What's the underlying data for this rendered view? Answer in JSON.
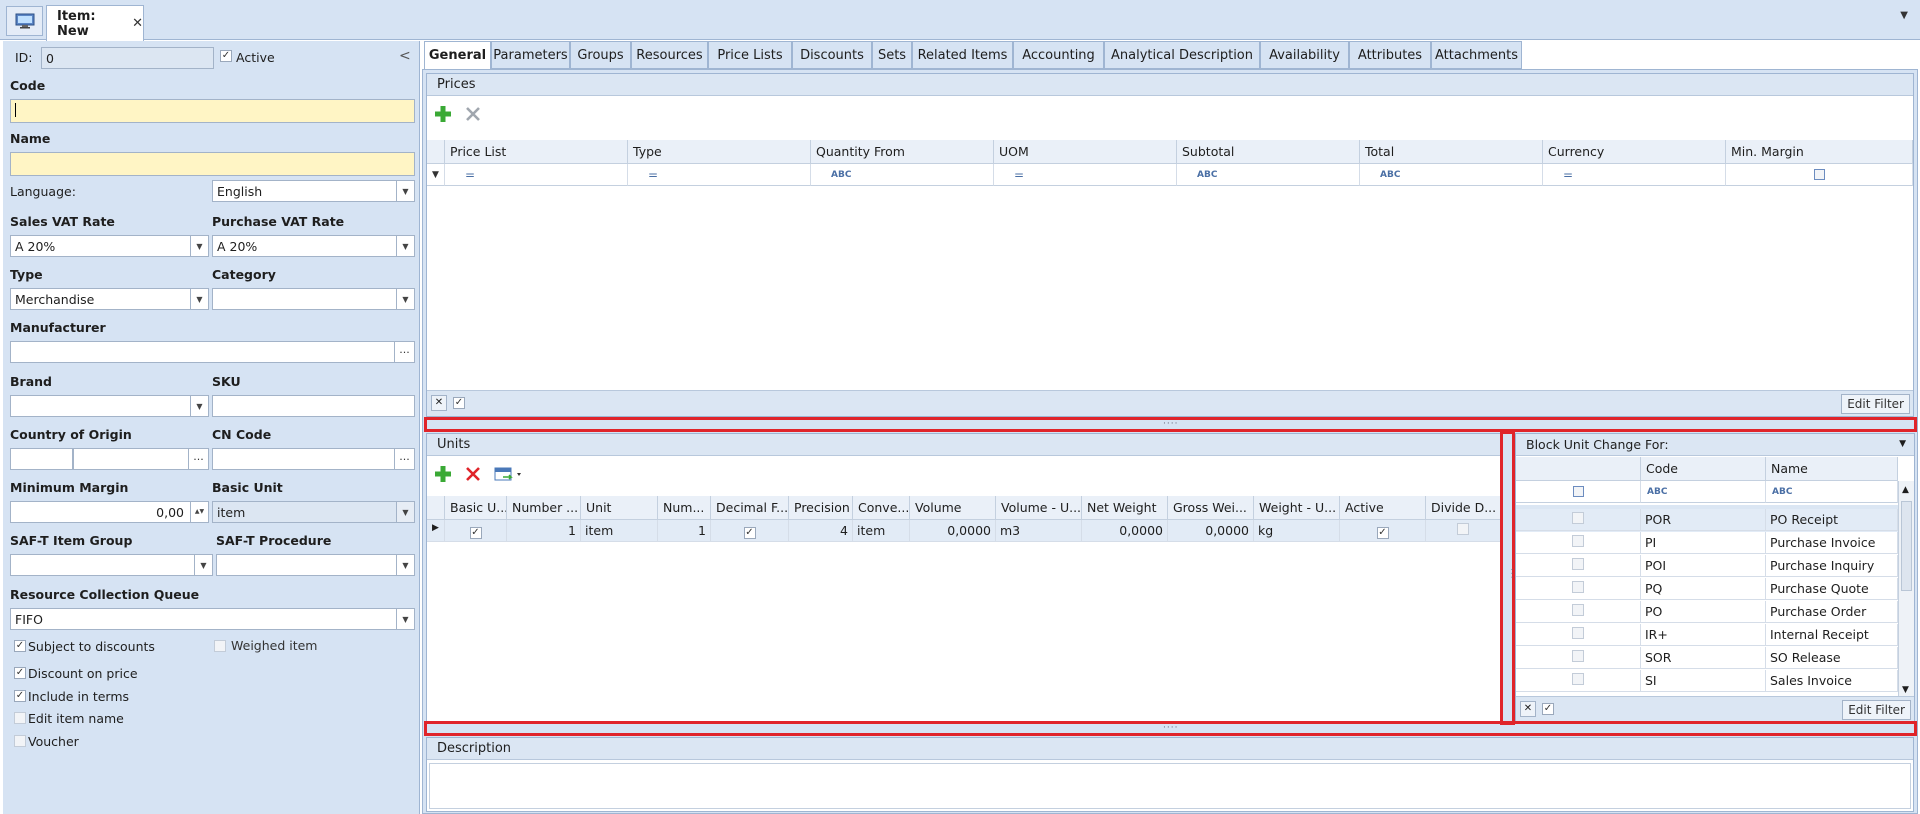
{
  "doc_tab": {
    "title": "Item: New",
    "close": "✕"
  },
  "left": {
    "id_label": "ID:",
    "id_value": "0",
    "active_label": "Active",
    "collapse": "<",
    "code_label": "Code",
    "code_value": "",
    "name_label": "Name",
    "name_value": "",
    "language_label": "Language:",
    "language_value": "English",
    "sales_vat_label": "Sales VAT Rate",
    "sales_vat_value": "A 20%",
    "purchase_vat_label": "Purchase VAT Rate",
    "purchase_vat_value": "A 20%",
    "type_label": "Type",
    "type_value": "Merchandise",
    "category_label": "Category",
    "category_value": "",
    "manufacturer_label": "Manufacturer",
    "manufacturer_value": "",
    "brand_label": "Brand",
    "brand_value": "",
    "sku_label": "SKU",
    "sku_value": "",
    "country_label": "Country of Origin",
    "cn_label": "CN Code",
    "min_margin_label": "Minimum Margin",
    "min_margin_value": "0,00",
    "basic_unit_label": "Basic Unit",
    "basic_unit_value": "item",
    "saft_group_label": "SAF-T Item Group",
    "saft_proc_label": "SAF-T Procedure",
    "rcq_label": "Resource Collection Queue",
    "rcq_value": "FIFO",
    "subject_discounts": "Subject to discounts",
    "weighed_item": "Weighed item",
    "discount_on_price": "Discount on price",
    "include_in_terms": "Include in terms",
    "edit_item_name": "Edit item name",
    "voucher": "Voucher",
    "check_mark": "✓",
    "ellipsis": "···",
    "dd_arrow": "▼",
    "spin": "▲▼"
  },
  "tabs": [
    "General",
    "Parameters",
    "Groups",
    "Resources",
    "Price Lists",
    "Discounts",
    "Sets",
    "Related Items",
    "Accounting",
    "Analytical Description",
    "Availability",
    "Attributes",
    "Attachments"
  ],
  "prices": {
    "title": "Prices",
    "columns": [
      "Price List",
      "Type",
      "Quantity From",
      "UOM",
      "Subtotal",
      "Total",
      "Currency",
      "Min. Margin"
    ],
    "filter_symbols": [
      "=",
      "=",
      "ABC",
      "=",
      "ABC",
      "ABC",
      "=",
      ""
    ],
    "edit_filter": "Edit Filter"
  },
  "units": {
    "title": "Units",
    "columns": [
      "Basic U...",
      "Number ...",
      "Unit",
      "Num...",
      "Decimal F...",
      "Precision",
      "Conve...",
      "Volume",
      "Volume - U...",
      "Net Weight",
      "Gross Wei...",
      "Weight - U...",
      "Active",
      "Divide D..."
    ],
    "row": [
      "✓",
      "1",
      "item",
      "1",
      "✓",
      "4",
      "item",
      "0,0000",
      "m3",
      "0,0000",
      "0,0000",
      "kg",
      "✓",
      ""
    ]
  },
  "block": {
    "title": "Block Unit Change For:",
    "col_code": "Code",
    "col_name": "Name",
    "rows": [
      {
        "code": "POR",
        "name": "PO Receipt"
      },
      {
        "code": "PI",
        "name": "Purchase Invoice"
      },
      {
        "code": "POI",
        "name": "Purchase Inquiry"
      },
      {
        "code": "PQ",
        "name": "Purchase Quote"
      },
      {
        "code": "PO",
        "name": "Purchase Order"
      },
      {
        "code": "IR+",
        "name": "Internal Receipt"
      },
      {
        "code": "SOR",
        "name": "SO Release"
      },
      {
        "code": "SI",
        "name": "Sales Invoice"
      }
    ],
    "edit_filter": "Edit Filter"
  },
  "description": {
    "title": "Description",
    "value": ""
  },
  "colors": {
    "accent_red": "#e0242a",
    "panel_blue": "#d6e3f3",
    "required_yellow": "#fff5c5",
    "add_green": "#3aa935"
  }
}
